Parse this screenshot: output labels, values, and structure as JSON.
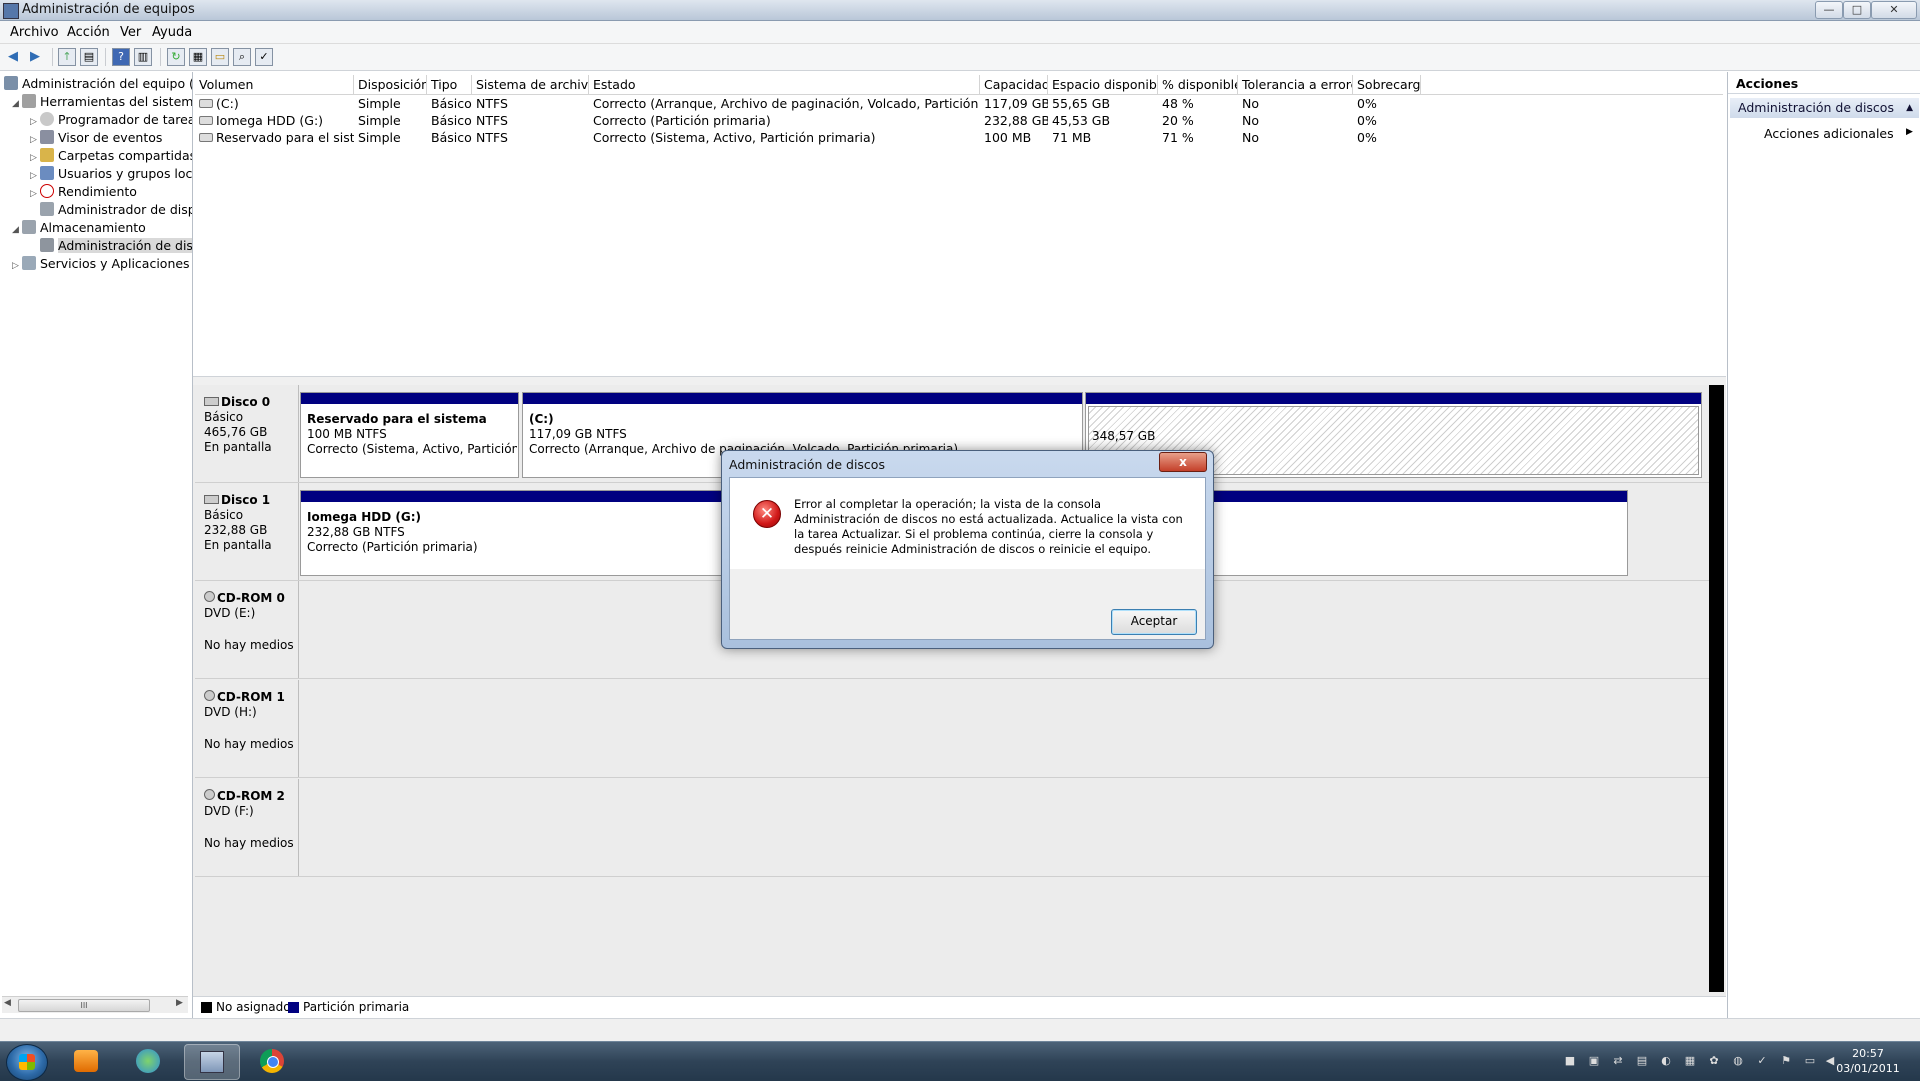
{
  "window": {
    "title": "Administración de equipos",
    "controls": {
      "minimize": "—",
      "maximize": "□",
      "close": "✕"
    }
  },
  "menu": [
    "Archivo",
    "Acción",
    "Ver",
    "Ayuda"
  ],
  "tree": {
    "items": [
      {
        "label": "Administración del equipo (loc",
        "icon": "computer-management-icon"
      },
      {
        "label": "Herramientas del sistema",
        "icon": "tools-icon"
      },
      {
        "label": "Programador de tareas",
        "icon": "clock-icon"
      },
      {
        "label": "Visor de eventos",
        "icon": "event-viewer-icon"
      },
      {
        "label": "Carpetas compartidas",
        "icon": "shared-folder-icon"
      },
      {
        "label": "Usuarios y grupos locale",
        "icon": "users-icon"
      },
      {
        "label": "Rendimiento",
        "icon": "performance-icon"
      },
      {
        "label": "Administrador de dispo",
        "icon": "device-manager-icon"
      },
      {
        "label": "Almacenamiento",
        "icon": "storage-icon"
      },
      {
        "label": "Administración de disco",
        "icon": "disk-management-icon"
      },
      {
        "label": "Servicios y Aplicaciones",
        "icon": "services-icon"
      }
    ],
    "scroll_thumb": "III"
  },
  "volumes": {
    "columns": [
      "Volumen",
      "Disposición",
      "Tipo",
      "Sistema de archivos",
      "Estado",
      "Capacidad",
      "Espacio disponible",
      "% disponible",
      "Tolerancia a errores",
      "Sobrecarga"
    ],
    "rows": [
      [
        "(C:)",
        "Simple",
        "Básico",
        "NTFS",
        "Correcto (Arranque, Archivo de paginación, Volcado, Partición primaria)",
        "117,09 GB",
        "55,65 GB",
        "48 %",
        "No",
        "0%"
      ],
      [
        "Iomega HDD (G:)",
        "Simple",
        "Básico",
        "NTFS",
        "Correcto (Partición primaria)",
        "232,88 GB",
        "45,53 GB",
        "20 %",
        "No",
        "0%"
      ],
      [
        "Reservado para el sistema",
        "Simple",
        "Básico",
        "NTFS",
        "Correcto (Sistema, Activo, Partición primaria)",
        "100 MB",
        "71 MB",
        "71 %",
        "No",
        "0%"
      ]
    ]
  },
  "disks": [
    {
      "name": "Disco 0",
      "type": "Básico",
      "size": "465,76 GB",
      "status": "En pantalla",
      "partitions": [
        {
          "title": "Reservado para el sistema",
          "size": "100 MB NTFS",
          "status": "Correcto (Sistema, Activo, Partición prir"
        },
        {
          "title": "(C:)",
          "size": "117,09 GB NTFS",
          "status": "Correcto (Arranque, Archivo de paginación, Volcado, Partición primaria)"
        },
        {
          "title": "",
          "size": "348,57 GB",
          "status": ""
        }
      ]
    },
    {
      "name": "Disco 1",
      "type": "Básico",
      "size": "232,88 GB",
      "status": "En pantalla",
      "partitions": [
        {
          "title": "Iomega HDD  (G:)",
          "size": "232,88 GB NTFS",
          "status": "Correcto (Partición primaria)"
        }
      ]
    },
    {
      "name": "CD-ROM 0",
      "type": "DVD (E:)",
      "media": "No hay medios"
    },
    {
      "name": "CD-ROM 1",
      "type": "DVD (H:)",
      "media": "No hay medios"
    },
    {
      "name": "CD-ROM 2",
      "type": "DVD (F:)",
      "media": "No hay medios"
    }
  ],
  "legend": [
    {
      "label": "No asignado",
      "color": "#000000"
    },
    {
      "label": "Partición primaria",
      "color": "#000080"
    }
  ],
  "actions": {
    "header": "Acciones",
    "section": "Administración de discos",
    "more": "Acciones adicionales"
  },
  "dialog": {
    "title": "Administración de discos",
    "message": "Error al completar la operación; la vista de la consola Administración de discos no está actualizada. Actualice la vista con la tarea Actualizar. Si el problema continúa, cierre la consola y después reinicie Administración de discos o reinicie el equipo.",
    "ok_label": "Aceptar",
    "close_label": "x"
  },
  "clock": {
    "time": "20:57",
    "date": "03/01/2011"
  },
  "colors": {
    "primary_partition": "#000080",
    "unallocated": "#000000",
    "selection": "#d9d9d9"
  }
}
